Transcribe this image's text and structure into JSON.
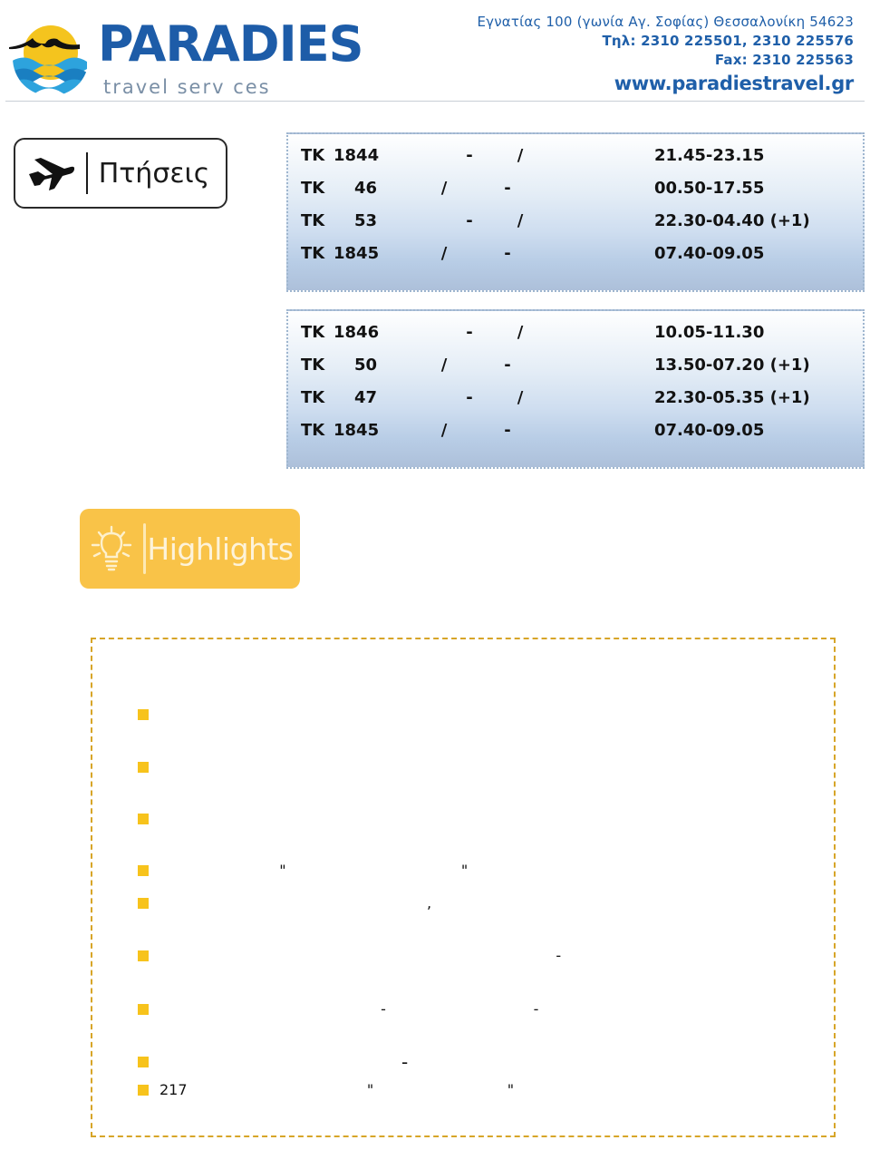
{
  "header": {
    "brand": {
      "wordmark": "PARADIES",
      "tagline": "travel serv ces",
      "logo_icon": "sun-over-sea-logo"
    },
    "contact": {
      "address": "Εγνατίας 100 (γωνία Αγ. Σοφίας) Θεσσαλονίκη 54623",
      "phone": "Τηλ: 2310 225501, 2310 225576",
      "fax": "Fax: 2310 225563",
      "website": "www.paradiestravel.gr"
    }
  },
  "flights_section": {
    "badge_label": "Πτήσεις",
    "badge_icon": "airplane-icon",
    "tables": [
      {
        "rows": [
          {
            "carrier": "TK",
            "number": "1844",
            "route_a": "-",
            "route_b": "/",
            "times": "21.45-23.15"
          },
          {
            "carrier": "TK",
            "number": "46",
            "route_a": "/",
            "route_b": "-",
            "times": "00.50-17.55"
          },
          {
            "carrier": "TK",
            "number": "53",
            "route_a": "-",
            "route_b": "/",
            "times": "22.30-04.40 (+1)"
          },
          {
            "carrier": "TK",
            "number": "1845",
            "route_a": "/",
            "route_b": "-",
            "times": "07.40-09.05"
          }
        ]
      },
      {
        "rows": [
          {
            "carrier": "TK",
            "number": "1846",
            "route_a": "-",
            "route_b": "/",
            "times": "10.05-11.30"
          },
          {
            "carrier": "TK",
            "number": "50",
            "route_a": "/",
            "route_b": "-",
            "times": "13.50-07.20 (+1)"
          },
          {
            "carrier": "TK",
            "number": "47",
            "route_a": "-",
            "route_b": "/",
            "times": "22.30-05.35 (+1)"
          },
          {
            "carrier": "TK",
            "number": "1845",
            "route_a": "/",
            "route_b": "-",
            "times": "07.40-09.05"
          }
        ]
      }
    ]
  },
  "highlights_section": {
    "banner_label": "Highlights",
    "banner_icon": "lightbulb-icon",
    "items": [
      {
        "text": ""
      },
      {
        "text": ""
      },
      {
        "text": ""
      },
      {
        "text": "                          \"                                      \""
      },
      {
        "text": "                                                          ,"
      },
      {
        "text": "                                                                                      -"
      },
      {
        "text": "                                                -                                -"
      },
      {
        "text": "                                          -"
      },
      {
        "text": "217                                       \"                             \""
      }
    ]
  }
}
